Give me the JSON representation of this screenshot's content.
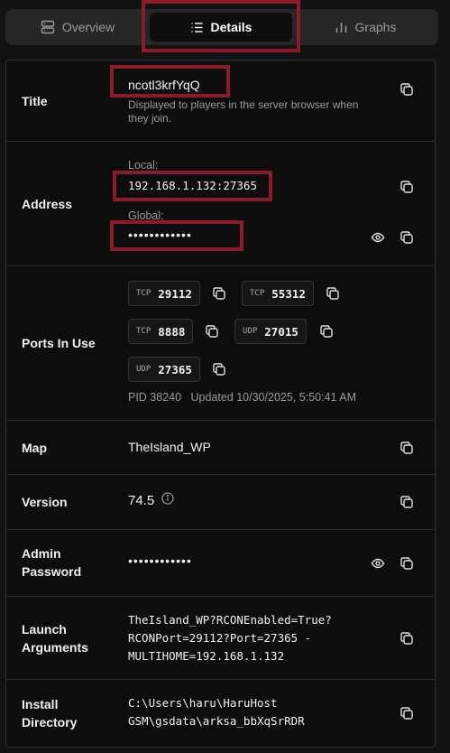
{
  "tabs": [
    {
      "label": "Overview",
      "icon": "server-icon",
      "active": false
    },
    {
      "label": "Details",
      "icon": "list-icon",
      "active": true
    },
    {
      "label": "Graphs",
      "icon": "bar-chart-icon",
      "active": false
    }
  ],
  "rows": {
    "title": {
      "label": "Title",
      "value": "ncotl3krfYqQ",
      "description": "Displayed to players in the server browser when they join."
    },
    "address": {
      "label": "Address",
      "local_label": "Local:",
      "local_value": "192.168.1.132:27365",
      "global_label": "Global:",
      "global_value": "••••••••••••"
    },
    "ports": {
      "label": "Ports In Use",
      "items": [
        {
          "proto": "TCP",
          "port": "29112"
        },
        {
          "proto": "TCP",
          "port": "55312"
        },
        {
          "proto": "TCP",
          "port": "8888"
        },
        {
          "proto": "UDP",
          "port": "27015"
        },
        {
          "proto": "UDP",
          "port": "27365"
        }
      ],
      "pid": "PID 38240",
      "updated": "Updated 10/30/2025, 5:50:41 AM"
    },
    "map": {
      "label": "Map",
      "value": "TheIsland_WP"
    },
    "version": {
      "label": "Version",
      "value": "74.5"
    },
    "admin_password": {
      "label_line1": "Admin",
      "label_line2": "Password",
      "value": "••••••••••••"
    },
    "launch_args": {
      "label_line1": "Launch",
      "label_line2": "Arguments",
      "line1": "TheIsland_WP?RCONEnabled=True?",
      "line2": "RCONPort=29112?Port=27365 -",
      "line3": "MULTIHOME=192.168.1.132"
    },
    "install_dir": {
      "label_line1": "Install",
      "label_line2": "Directory",
      "line1": "C:\\Users\\haru\\HaruHost",
      "line2": "GSM\\gsdata\\arksa_bbXqSrRDR"
    }
  },
  "colors": {
    "background": "#121212",
    "highlight": "#8b1a2b",
    "card": "#0d0d0d",
    "tabbar": "#262626"
  }
}
